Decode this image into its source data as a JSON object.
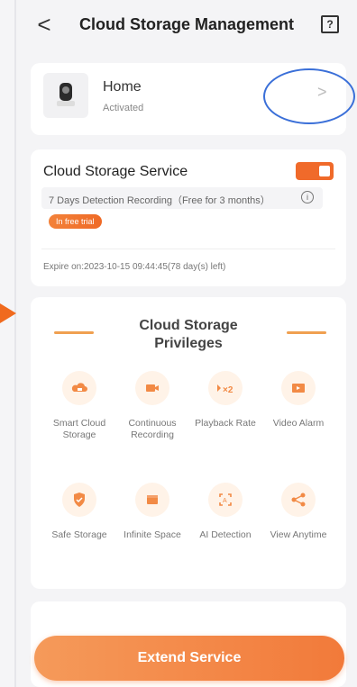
{
  "header": {
    "back_glyph": "<",
    "title": "Cloud Storage Management",
    "help_glyph": "?"
  },
  "device": {
    "name": "Home",
    "status": "Activated",
    "chevron_glyph": ">"
  },
  "service": {
    "title": "Cloud Storage Service",
    "enabled": true,
    "description": "7 Days Detection Recording（Free for 3 months）",
    "info_glyph": "i",
    "badge": "In free trial",
    "expire": "Expire on:2023-10-15 09:44:45(78 day(s) left)"
  },
  "privileges": {
    "title": "Cloud Storage Privileges",
    "items": [
      {
        "label": "Smart Cloud Storage",
        "icon": "cloud-camera-icon"
      },
      {
        "label": "Continuous Recording",
        "icon": "video-camera-icon"
      },
      {
        "label": "Playback Rate",
        "icon": "playback-rate-icon"
      },
      {
        "label": "Video Alarm",
        "icon": "video-alarm-icon"
      },
      {
        "label": "Safe Storage",
        "icon": "shield-icon"
      },
      {
        "label": "Infinite Space",
        "icon": "box-icon"
      },
      {
        "label": "AI Detection",
        "icon": "ai-detection-icon"
      },
      {
        "label": "View Anytime",
        "icon": "share-icon"
      }
    ]
  },
  "footer": {
    "extend_label": "Extend Service"
  },
  "colors": {
    "accent": "#f06a2a",
    "link_circle": "#3a6fd8"
  }
}
